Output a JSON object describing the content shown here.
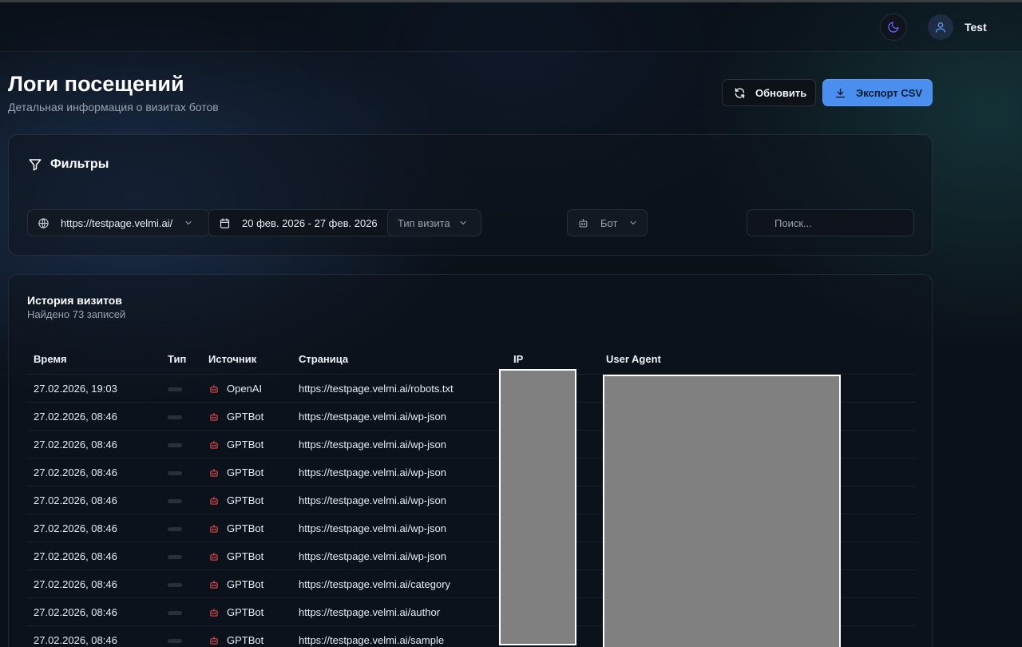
{
  "header": {
    "username": "Test",
    "icons": {
      "theme": "moon-icon",
      "avatar": "user-icon"
    }
  },
  "page": {
    "title": "Логи посещений",
    "subtitle": "Детальная информация о визитах ботов"
  },
  "actions": {
    "refresh_label": "Обновить",
    "export_label": "Экспорт CSV"
  },
  "filters": {
    "title": "Фильтры",
    "site": "https://testpage.velmi.ai/",
    "date_range": "20 фев. 2026 - 27 фев. 2026",
    "visit_type": "Тип визита",
    "bot": "Бот",
    "search_placeholder": "Поиск..."
  },
  "history": {
    "title": "История визитов",
    "count_text": "Найдено 73 записей",
    "columns": [
      "Время",
      "Тип",
      "Источник",
      "Страница",
      "IP",
      "User Agent"
    ],
    "rows": [
      {
        "time": "27.02.2026, 19:03",
        "source": "OpenAI",
        "page": "https://testpage.velmi.ai/robots.txt"
      },
      {
        "time": "27.02.2026, 08:46",
        "source": "GPTBot",
        "page": "https://testpage.velmi.ai/wp-json"
      },
      {
        "time": "27.02.2026, 08:46",
        "source": "GPTBot",
        "page": "https://testpage.velmi.ai/wp-json"
      },
      {
        "time": "27.02.2026, 08:46",
        "source": "GPTBot",
        "page": "https://testpage.velmi.ai/wp-json"
      },
      {
        "time": "27.02.2026, 08:46",
        "source": "GPTBot",
        "page": "https://testpage.velmi.ai/wp-json"
      },
      {
        "time": "27.02.2026, 08:46",
        "source": "GPTBot",
        "page": "https://testpage.velmi.ai/wp-json"
      },
      {
        "time": "27.02.2026, 08:46",
        "source": "GPTBot",
        "page": "https://testpage.velmi.ai/wp-json"
      },
      {
        "time": "27.02.2026, 08:46",
        "source": "GPTBot",
        "page": "https://testpage.velmi.ai/category"
      },
      {
        "time": "27.02.2026, 08:46",
        "source": "GPTBot",
        "page": "https://testpage.velmi.ai/author"
      },
      {
        "time": "27.02.2026, 08:46",
        "source": "GPTBot",
        "page": "https://testpage.velmi.ai/sample"
      }
    ]
  },
  "colors": {
    "accent": "#4a8ff0",
    "bot_icon": "#e0484c",
    "background": "#0b1119"
  }
}
